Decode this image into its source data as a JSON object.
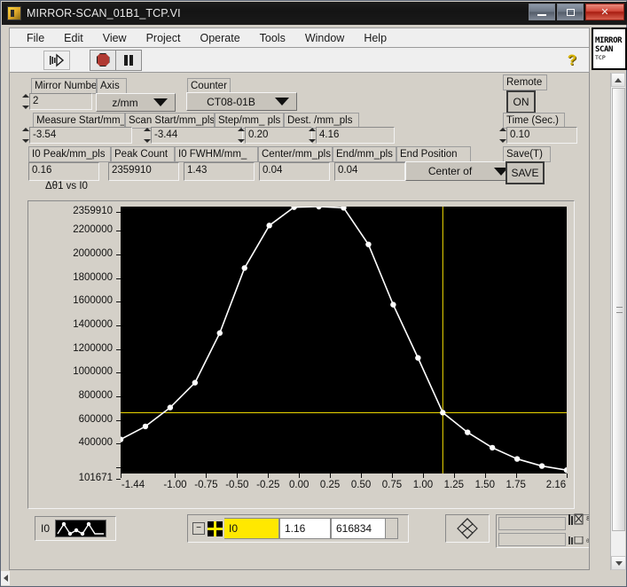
{
  "window": {
    "title": "MIRROR-SCAN_01B1_TCP.VI",
    "icon_name": "labview-vi-icon",
    "buttons": {
      "minimize": "minimize",
      "maximize": "maximize",
      "close": "✕"
    }
  },
  "menu": {
    "items": [
      "File",
      "Edit",
      "View",
      "Project",
      "Operate",
      "Tools",
      "Window",
      "Help"
    ]
  },
  "toolbar": {
    "run_continuously": "run-continuously",
    "abort": "abort-execution",
    "pause": "pause",
    "help": "?"
  },
  "vi_icon": {
    "line1": "MIRROR",
    "line2": "SCAN",
    "line3": "TCP"
  },
  "controls": {
    "mirror_number": {
      "label": "Mirror Number",
      "value": "2"
    },
    "axis": {
      "label": "Axis",
      "value": "z/mm"
    },
    "counter": {
      "label": "Counter",
      "value": "CT08-01B"
    },
    "remote": {
      "label": "Remote",
      "value": "ON"
    },
    "measure_start": {
      "label": "Measure Start/mm_pls",
      "value": "-3.54"
    },
    "scan_start": {
      "label": "Scan Start/mm_pls",
      "value": "-3.44"
    },
    "step": {
      "label": "Step/mm_ pls",
      "value": "0.20"
    },
    "dest": {
      "label": "Dest. /mm_pls",
      "value": "4.16"
    },
    "time_sec": {
      "label": "Time (Sec.)",
      "value": "0.10"
    },
    "i0_peak": {
      "label": "I0 Peak/mm_pls",
      "value": "0.16"
    },
    "peak_count": {
      "label": "Peak Count",
      "value": "2359910"
    },
    "i0_fwhm": {
      "label": "I0 FWHM/mm_",
      "value": "1.43"
    },
    "center": {
      "label": "Center/mm_pls",
      "value": "0.04"
    },
    "end": {
      "label": "End/mm_pls",
      "value": "0.04"
    },
    "end_position": {
      "label": "End Position",
      "value": "Center of"
    },
    "save": {
      "label": "Save(T)",
      "value": "SAVE"
    }
  },
  "graph": {
    "title": "Δθ1 vs I0",
    "legend": {
      "plot_name": "I0"
    },
    "cursor_legend": {
      "collapse": "−",
      "cursor_name": "I0",
      "x_value": "1.16",
      "y_value": "616834"
    }
  },
  "chart_data": {
    "type": "line",
    "title": "Δθ1 vs I0",
    "xlabel": "",
    "ylabel": "",
    "legend": [
      "I0"
    ],
    "legend_position": "bottom-left",
    "grid": false,
    "xlim": [
      -1.44,
      2.16
    ],
    "ylim": [
      101671,
      2359910
    ],
    "xticks": [
      -1.44,
      -1.0,
      -0.75,
      -0.5,
      -0.25,
      0.0,
      0.25,
      0.5,
      0.75,
      1.0,
      1.25,
      1.5,
      1.75,
      2.16
    ],
    "xtick_labels": [
      "-1.44",
      "-1.00",
      "-0.75",
      "-0.50",
      "-0.25",
      "0.00",
      "0.25",
      "0.50",
      "0.75",
      "1.00",
      "1.25",
      "1.50",
      "1.75",
      "2.16"
    ],
    "yticks": [
      101671,
      200000,
      400000,
      600000,
      800000,
      1000000,
      1200000,
      1400000,
      1600000,
      1800000,
      2000000,
      2200000,
      2359910
    ],
    "ytick_labels": [
      "101671",
      "",
      "400000",
      "600000",
      "800000",
      "1000000",
      "1200000",
      "1400000",
      "1600000",
      "1800000",
      "2000000",
      "2200000",
      "2359910"
    ],
    "series": [
      {
        "name": "I0",
        "marker": "circle",
        "color": "#ffffff",
        "x": [
          -1.44,
          -1.24,
          -1.04,
          -0.84,
          -0.64,
          -0.44,
          -0.24,
          -0.04,
          0.16,
          0.36,
          0.56,
          0.76,
          0.96,
          1.16,
          1.36,
          1.56,
          1.76,
          1.96,
          2.16
        ],
        "y": [
          390000,
          500000,
          660000,
          870000,
          1290000,
          1840000,
          2200000,
          2355000,
          2359910,
          2350000,
          2040000,
          1530000,
          1080000,
          616834,
          450000,
          320000,
          225000,
          165000,
          130000
        ]
      }
    ],
    "cursors": [
      {
        "name": "I0",
        "x": 1.16,
        "y": 616834,
        "color": "#ffe800"
      }
    ]
  },
  "palette": {
    "cursor_mover": "cursor-mover",
    "zoom_tool": "zoom-tool",
    "pan_tool": "pan-tool"
  }
}
